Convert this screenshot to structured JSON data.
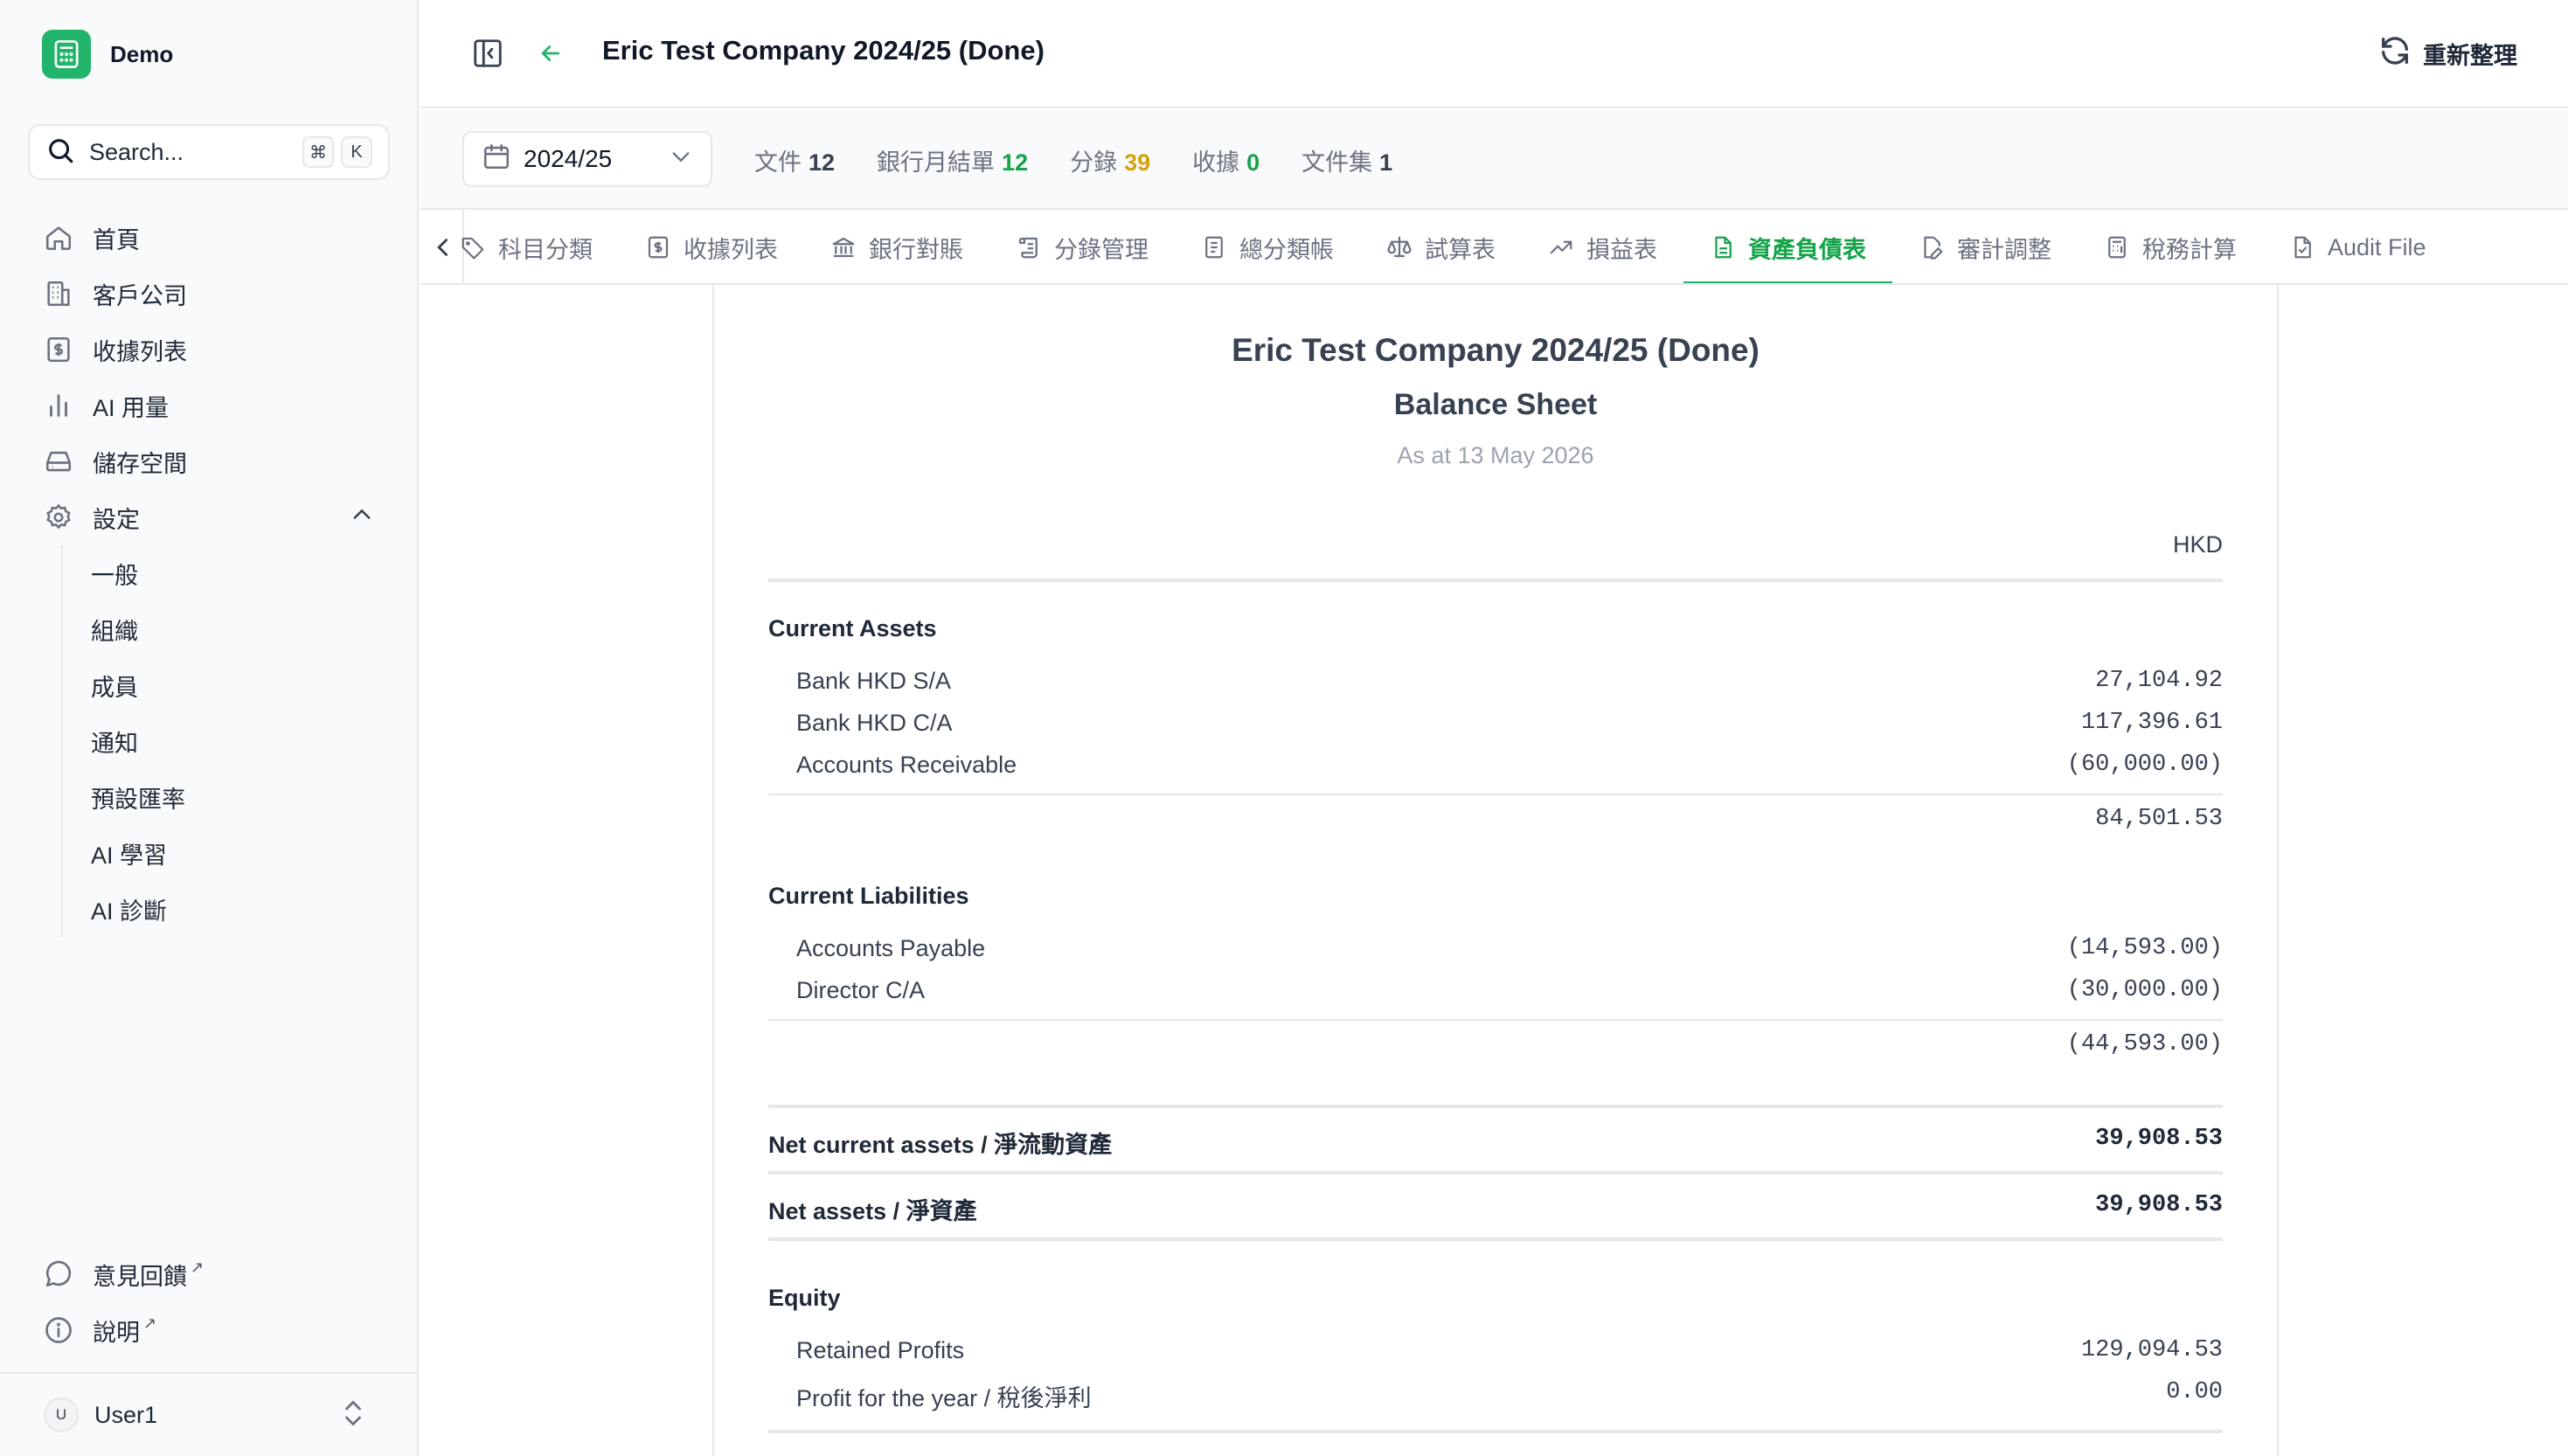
{
  "brand": {
    "name": "Demo"
  },
  "search": {
    "label": "Search...",
    "key1": "⌘",
    "key2": "K"
  },
  "nav": {
    "items": [
      {
        "label": "首頁"
      },
      {
        "label": "客戶公司"
      },
      {
        "label": "收據列表"
      },
      {
        "label": "AI 用量"
      },
      {
        "label": "儲存空間"
      },
      {
        "label": "設定"
      }
    ],
    "settings_sub": [
      {
        "label": "一般"
      },
      {
        "label": "組織"
      },
      {
        "label": "成員"
      },
      {
        "label": "通知"
      },
      {
        "label": "預設匯率"
      },
      {
        "label": "AI 學習"
      },
      {
        "label": "AI 診斷"
      }
    ],
    "bottom": [
      {
        "label": "意見回饋",
        "ext": "↗"
      },
      {
        "label": "說明",
        "ext": "↗"
      }
    ]
  },
  "user": {
    "initial": "U",
    "name": "User1"
  },
  "header": {
    "title": "Eric Test Company 2024/25 (Done)",
    "refresh_label": "重新整理"
  },
  "filter": {
    "year": "2024/25",
    "stats": [
      {
        "label": "文件",
        "value": "12",
        "color": "#374151"
      },
      {
        "label": "銀行月結單",
        "value": "12",
        "color": "#16a34a"
      },
      {
        "label": "分錄",
        "value": "39",
        "color": "#d4a20a"
      },
      {
        "label": "收據",
        "value": "0",
        "color": "#16a34a"
      },
      {
        "label": "文件集",
        "value": "1",
        "color": "#374151"
      }
    ]
  },
  "tabs": [
    {
      "label": "科目分類",
      "icon": "tag-icon"
    },
    {
      "label": "收據列表",
      "icon": "receipt-icon"
    },
    {
      "label": "銀行對賬",
      "icon": "bank-icon"
    },
    {
      "label": "分錄管理",
      "icon": "scroll-icon"
    },
    {
      "label": "總分類帳",
      "icon": "book-icon"
    },
    {
      "label": "試算表",
      "icon": "scale-icon"
    },
    {
      "label": "損益表",
      "icon": "trend-icon"
    },
    {
      "label": "資產負債表",
      "icon": "sheet-icon",
      "active": true
    },
    {
      "label": "審計調整",
      "icon": "file-edit-icon"
    },
    {
      "label": "稅務計算",
      "icon": "calculator-icon"
    },
    {
      "label": "Audit File",
      "icon": "file-check-icon"
    }
  ],
  "report": {
    "company": "Eric Test Company 2024/25 (Done)",
    "title": "Balance Sheet",
    "date": "As at 13 May 2026",
    "currency": "HKD",
    "current_assets": {
      "title": "Current Assets",
      "lines": [
        {
          "label": "Bank HKD S/A",
          "value": "27,104.92"
        },
        {
          "label": "Bank HKD C/A",
          "value": "117,396.61"
        },
        {
          "label": "Accounts Receivable",
          "value": "(60,000.00)"
        }
      ],
      "total": "84,501.53"
    },
    "current_liabilities": {
      "title": "Current Liabilities",
      "lines": [
        {
          "label": "Accounts Payable",
          "value": "(14,593.00)"
        },
        {
          "label": "Director C/A",
          "value": "(30,000.00)"
        }
      ],
      "total": "(44,593.00)"
    },
    "net_current_assets": {
      "label": "Net current assets / 淨流動資產",
      "value": "39,908.53"
    },
    "net_assets": {
      "label": "Net assets / 淨資產",
      "value": "39,908.53"
    },
    "equity": {
      "title": "Equity",
      "lines": [
        {
          "label": "Retained Profits",
          "value": "129,094.53"
        },
        {
          "label": "Profit for the year / 稅後淨利",
          "value": "0.00"
        }
      ]
    }
  }
}
